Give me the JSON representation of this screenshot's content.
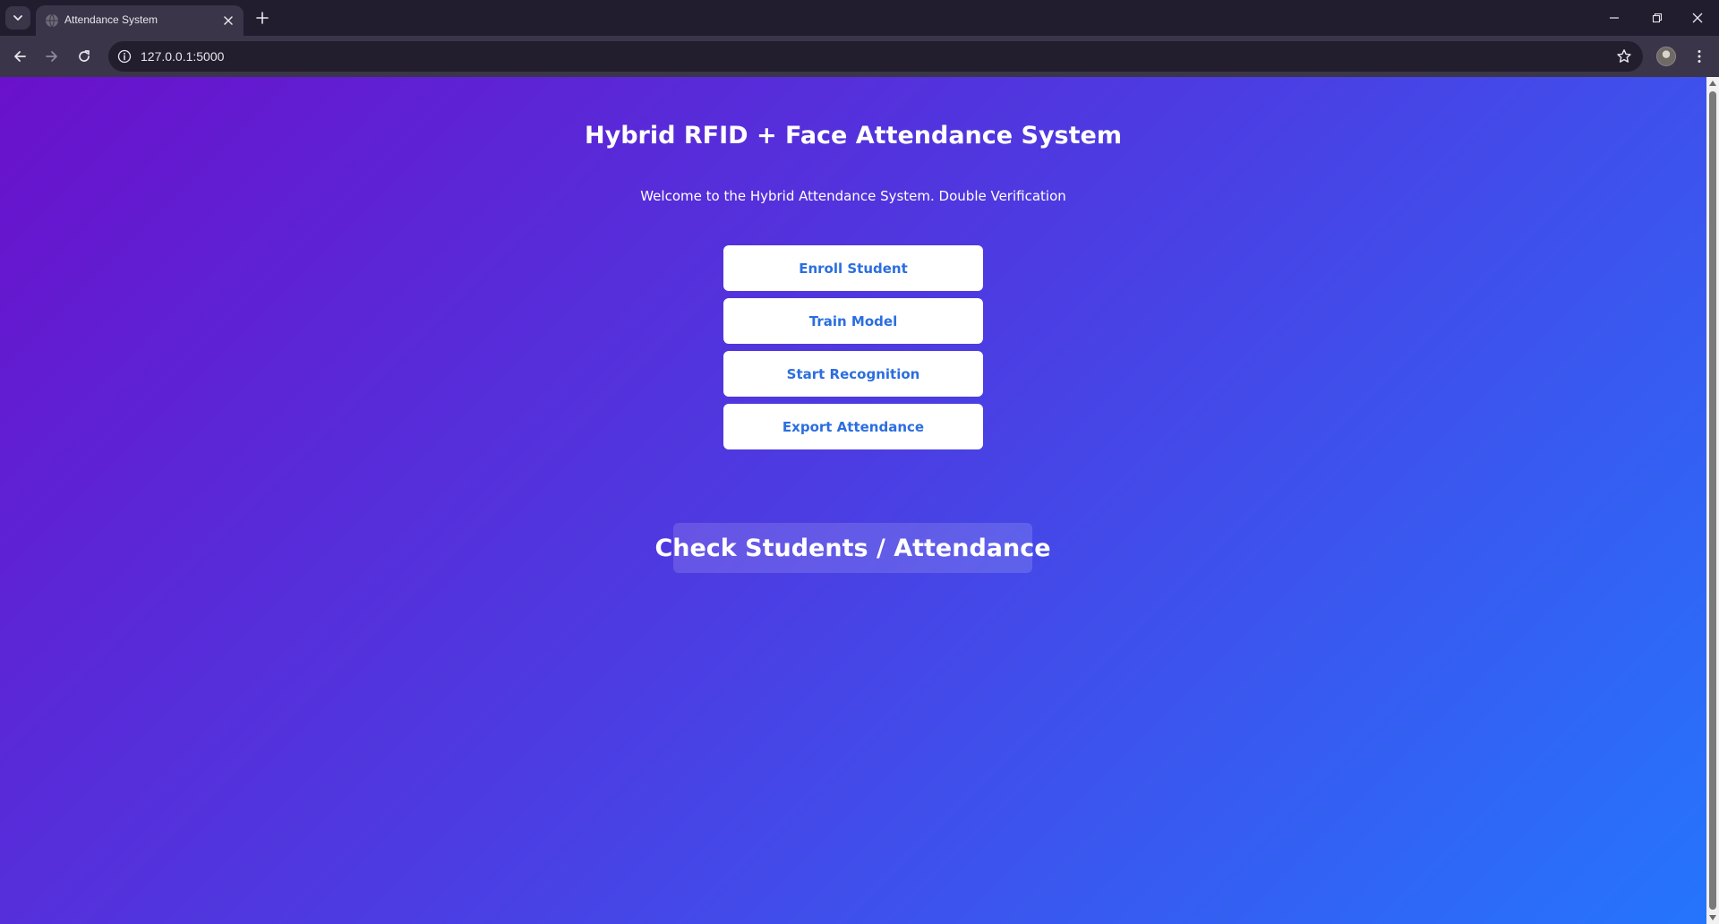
{
  "browser": {
    "tab": {
      "title": "Attendance System"
    },
    "address_bar": {
      "url": "127.0.0.1:5000"
    }
  },
  "page": {
    "title": "Hybrid RFID + Face Attendance System",
    "subtitle": "Welcome to the Hybrid Attendance System. Double Verification",
    "actions": [
      {
        "label": "Enroll Student"
      },
      {
        "label": "Train Model"
      },
      {
        "label": "Start Recognition"
      },
      {
        "label": "Export Attendance"
      }
    ],
    "check_link": {
      "label": "Check Students / Attendance"
    }
  },
  "colors": {
    "gradient_start": "#6a11cb",
    "gradient_end": "#2575fc",
    "button_text": "#2b6ee0",
    "button_bg": "#ffffff"
  }
}
